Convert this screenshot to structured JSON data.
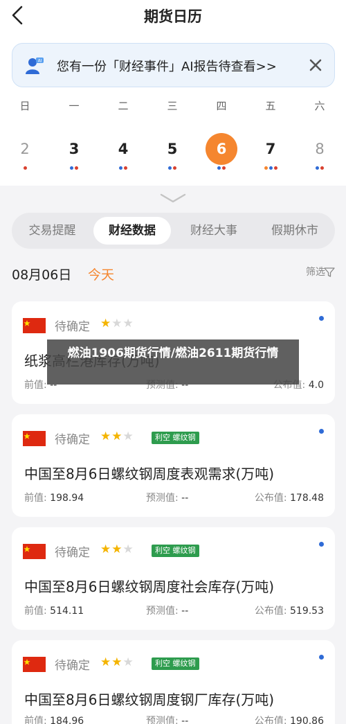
{
  "nav": {
    "title": "期货日历"
  },
  "banner": {
    "text": "您有一份「财经事件」AI报告待查看>>"
  },
  "week": {
    "weekdays": [
      "日",
      "一",
      "二",
      "三",
      "四",
      "五",
      "六"
    ],
    "days": [
      "2",
      "3",
      "4",
      "5",
      "6",
      "7",
      "8"
    ],
    "selected_index": 4
  },
  "tabs": [
    "交易提醒",
    "财经数据",
    "财经大事",
    "假期休市"
  ],
  "active_tab": "财经数据",
  "date": {
    "label": "08月06日",
    "today": "今天",
    "filter": "筛选"
  },
  "overlay": {
    "text": "燃油1906期货行情/燃油2611期货行情"
  },
  "cards": [
    {
      "status": "待确定",
      "stars": 1,
      "tag": "",
      "title": "纸浆高栏港库存(万吨)",
      "prev_label": "前值:",
      "prev": "--",
      "forecast_label": "预测值:",
      "forecast": "--",
      "actual_label": "公布值:",
      "actual": "4.0"
    },
    {
      "status": "待确定",
      "stars": 2,
      "tag": "利空 螺纹钢",
      "title": "中国至8月6日螺纹钢周度表观需求(万吨)",
      "prev_label": "前值:",
      "prev": "198.94",
      "forecast_label": "预测值:",
      "forecast": "--",
      "actual_label": "公布值:",
      "actual": "178.48"
    },
    {
      "status": "待确定",
      "stars": 2,
      "tag": "利空 螺纹钢",
      "title": "中国至8月6日螺纹钢周度社会库存(万吨)",
      "prev_label": "前值:",
      "prev": "514.11",
      "forecast_label": "预测值:",
      "forecast": "--",
      "actual_label": "公布值:",
      "actual": "519.53"
    },
    {
      "status": "待确定",
      "stars": 2,
      "tag": "利空 螺纹钢",
      "title": "中国至8月6日螺纹钢周度钢厂库存(万吨)",
      "prev_label": "前值:",
      "prev": "184.96",
      "forecast_label": "预测值:",
      "forecast": "--",
      "actual_label": "公布值:",
      "actual": "190.86"
    }
  ],
  "colors": {
    "accent": "#f5862f",
    "tag_green": "#2e9c4e",
    "dot_blue": "#2f6bd6",
    "dot_red": "#d9412f",
    "dot_orange": "#f5862f"
  }
}
